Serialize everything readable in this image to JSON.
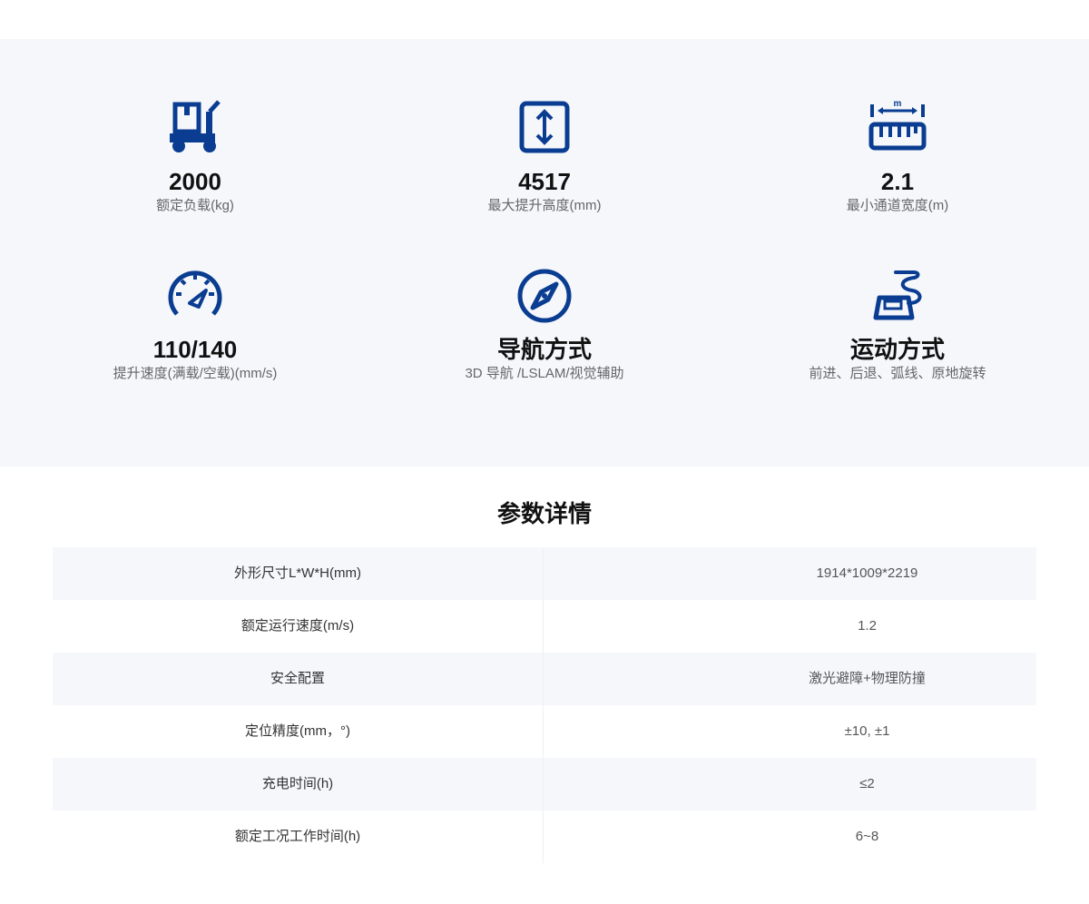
{
  "colors": {
    "accent": "#0a3d91",
    "panel_bg": "#f5f7fb"
  },
  "features": [
    {
      "icon": "forklift-cart-icon",
      "value": "2000",
      "label": "额定负载(kg)"
    },
    {
      "icon": "lift-height-icon",
      "value": "4517",
      "label": "最大提升高度(mm)"
    },
    {
      "icon": "ruler-width-icon",
      "value": "2.1",
      "label": "最小通道宽度(m)"
    },
    {
      "icon": "speedometer-icon",
      "value": "110/140",
      "label": "提升速度(满载/空载)(mm/s)"
    },
    {
      "icon": "compass-icon",
      "value": "导航方式",
      "label": "3D 导航 /LSLAM/视觉辅助"
    },
    {
      "icon": "motion-icon",
      "value": "运动方式",
      "label": "前进、后退、弧线、原地旋转"
    }
  ],
  "ruler_unit": "m",
  "specs": {
    "title": "参数详情",
    "rows": [
      {
        "name": "外形尺寸L*W*H(mm)",
        "value": "1914*1009*2219"
      },
      {
        "name": "额定运行速度(m/s)",
        "value": "1.2"
      },
      {
        "name": "安全配置",
        "value": "激光避障+物理防撞"
      },
      {
        "name": "定位精度(mm，°)",
        "value": "±10, ±1"
      },
      {
        "name": "充电时间(h)",
        "value": "≤2"
      },
      {
        "name": "额定工况工作时间(h)",
        "value": "6~8"
      }
    ]
  }
}
